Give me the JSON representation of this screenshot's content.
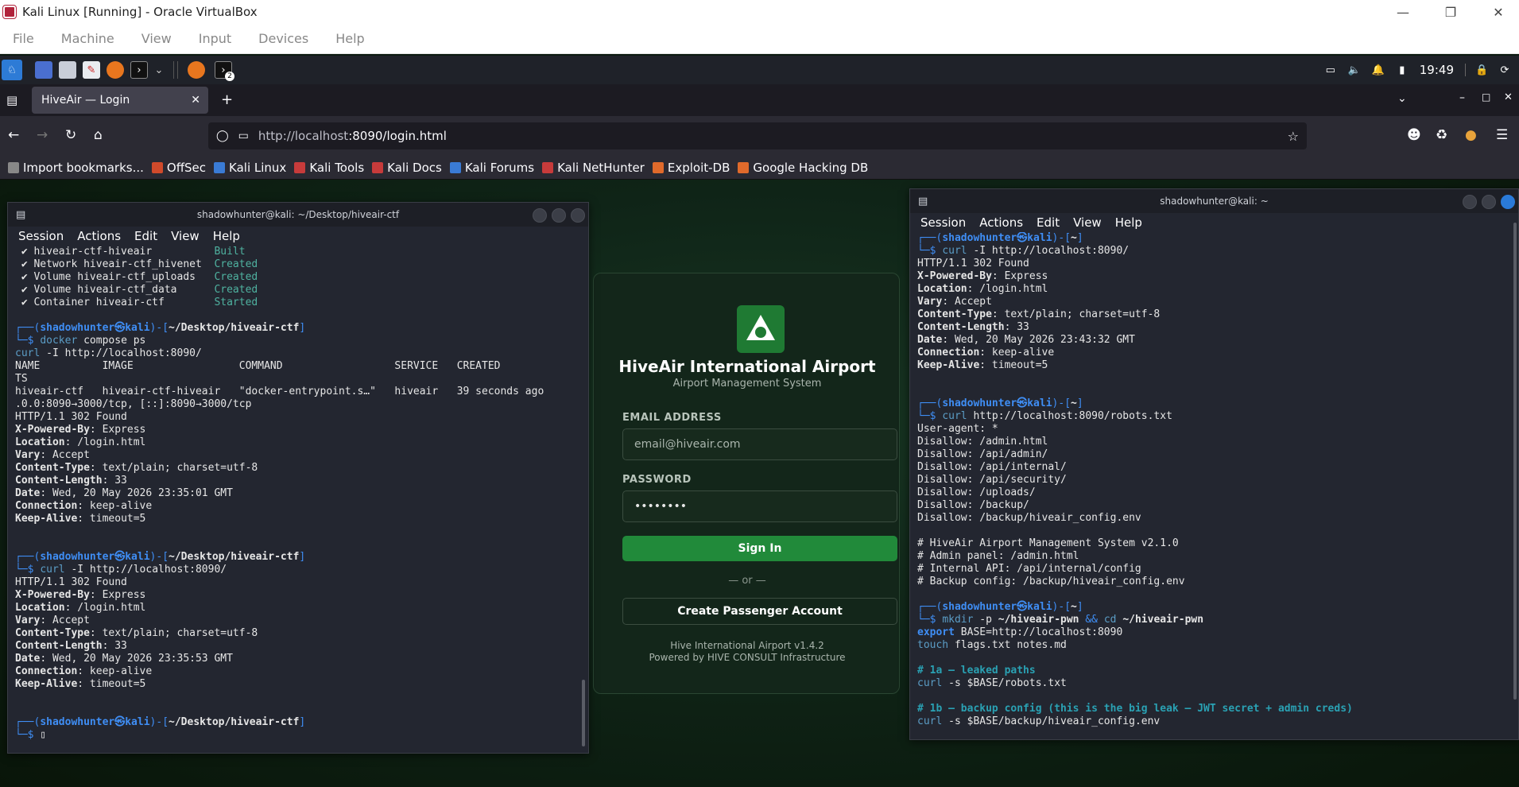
{
  "vbox": {
    "title": "Kali Linux [Running] - Oracle VirtualBox",
    "menu": [
      "File",
      "Machine",
      "View",
      "Input",
      "Devices",
      "Help"
    ]
  },
  "panel": {
    "clock": "19:49",
    "badge": "2"
  },
  "browser": {
    "tab_title": "HiveAir — Login",
    "url_host": "http://localhost",
    "url_rest": ":8090/login.html",
    "bookmarks": [
      "Import bookmarks...",
      "OffSec",
      "Kali Linux",
      "Kali Tools",
      "Kali Docs",
      "Kali Forums",
      "Kali NetHunter",
      "Exploit-DB",
      "Google Hacking DB"
    ]
  },
  "term_menu": [
    "Session",
    "Actions",
    "Edit",
    "View",
    "Help"
  ],
  "term_left": {
    "title": "shadowhunter@kali: ~/Desktop/hiveair-ctf"
  },
  "term_right": {
    "title": "shadowhunter@kali: ~"
  },
  "login": {
    "title": "HiveAir International Airport",
    "subtitle": "Airport Management System",
    "email_label": "EMAIL ADDRESS",
    "email_placeholder": "email@hiveair.com",
    "password_label": "PASSWORD",
    "password_value": "••••••••",
    "sign_in": "Sign In",
    "or": "— or —",
    "create": "Create Passenger Account",
    "footer1": "Hive International Airport v1.4.2",
    "footer2": "Powered by HIVE CONSULT Infrastructure"
  },
  "colors": {
    "accent_green": "#218a3a",
    "prompt_blue": "#3f8ef5",
    "comment_cyan": "#2aa1b3"
  },
  "icons": [
    "kali-menu-icon",
    "desktop-icon",
    "files-icon",
    "text-editor-icon",
    "firefox-icon",
    "terminal-icon",
    "screen-icon",
    "volume-icon",
    "bell-icon",
    "battery-icon",
    "lock-icon",
    "power-icon"
  ]
}
